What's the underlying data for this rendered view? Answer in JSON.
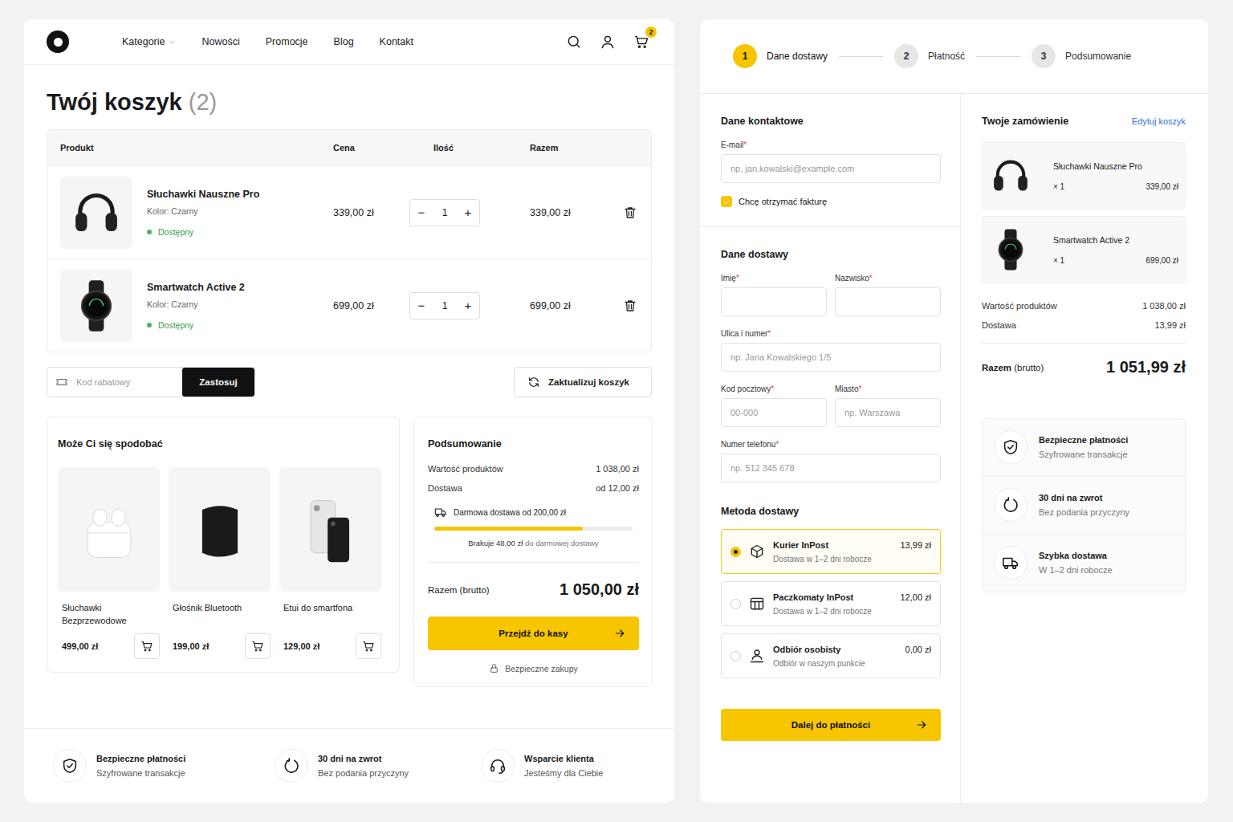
{
  "nav": {
    "items": [
      {
        "label": "Kategorie",
        "dropdown": true
      },
      {
        "label": "Nowości",
        "dropdown": false
      },
      {
        "label": "Promocje",
        "dropdown": false
      },
      {
        "label": "Blog",
        "dropdown": false
      },
      {
        "label": "Kontakt",
        "dropdown": false
      }
    ],
    "cart_badge": "2"
  },
  "cart": {
    "title": "Twój koszyk",
    "count": "(2)",
    "columns": [
      "Produkt",
      "Cena",
      "Ilość",
      "Razem"
    ],
    "qty_minus": "−",
    "qty_plus": "+",
    "items": [
      {
        "name": "Słuchawki Nauszne Pro",
        "color_label": "Kolor: Czarny",
        "availability": "Dostępny",
        "available": true,
        "price": "339,00 zł",
        "qty": "1",
        "total": "339,00 zł",
        "kind": "headphones"
      },
      {
        "name": "Smartwatch Active 2",
        "color_label": "Kolor: Czarny",
        "availability": "Dostępny",
        "available": true,
        "price": "699,00 zł",
        "qty": "1",
        "total": "699,00 zł",
        "kind": "watch"
      }
    ]
  },
  "coupon": {
    "placeholder": "Kod rabatowy",
    "button": "Zastosuj"
  },
  "update_button": "Zaktualizuj koszyk",
  "recommendations": {
    "title": "Może Ci się spodobać",
    "items": [
      {
        "name": "Słuchawki Bezprzewodowe",
        "price": "499,00 zł",
        "kind": "earbuds"
      },
      {
        "name": "Głośnik Bluetooth",
        "price": "199,00 zł",
        "kind": "speaker"
      },
      {
        "name": "Etui do smartfona",
        "price": "129,00 zł",
        "kind": "case"
      }
    ]
  },
  "summary": {
    "title": "Podsumowanie",
    "lines": [
      {
        "label": "Wartość produktów",
        "value": "1 038,00 zł"
      },
      {
        "label": "Dostawa",
        "value": "od 12,00 zł"
      }
    ],
    "free_shipping": {
      "label": "Darmowa dostawa od 200,00 zł",
      "level": 0.75,
      "remaining_amount": "Brakuje 48,00 zł",
      "remaining_rest": "do darmowej dostawy"
    },
    "total_label": "Razem (brutto)",
    "total": "1 050,00 zł",
    "checkout": "Przejdź do kasy",
    "secure": "Bezpieczne zakupy"
  },
  "footer": [
    {
      "title": "Bezpieczne płatności",
      "subtitle": "Szyfrowane transakcje",
      "kind": "shield"
    },
    {
      "title": "30 dni na zwrot",
      "subtitle": "Bez podania przyczyny",
      "kind": "return"
    },
    {
      "title": "Wsparcie klienta",
      "subtitle": "Jesteśmy dla Ciebie",
      "kind": "support"
    }
  ],
  "checkout": {
    "steps": [
      {
        "number": "1",
        "label": "Dane dostawy",
        "selected": true
      },
      {
        "number": "2",
        "label": "Płatność",
        "selected": false
      },
      {
        "number": "3",
        "label": "Podsumowanie",
        "selected": false
      }
    ],
    "required_mark": "*",
    "contact": {
      "title": "Dane kontaktowe",
      "email": {
        "label": "E-mail",
        "placeholder": "np. jan.kowalski@example.com",
        "required": true
      },
      "invoice": {
        "label": "Chcę otrzymać fakturę",
        "checked": true
      }
    },
    "delivery": {
      "title": "Dane dostawy",
      "rows": [
        [
          {
            "label": "Imię",
            "required": true
          },
          {
            "label": "Nazwisko",
            "required": true
          }
        ],
        [
          {
            "label": "Ulica i numer",
            "placeholder": "np. Jana Kowalskiego 1/5",
            "required": true
          }
        ],
        [
          {
            "label": "Kod pocztowy",
            "placeholder": "00-000",
            "required": true
          },
          {
            "label": "Miasto",
            "placeholder": "np. Warszawa",
            "required": true
          }
        ],
        [
          {
            "label": "Numer telefonu",
            "placeholder": "np. 512 345 678",
            "required": true
          }
        ]
      ]
    },
    "methods": {
      "title": "Metoda dostawy",
      "options": [
        {
          "name": "Kurier InPost",
          "detail": "Dostawa w 1–2 dni robocze",
          "price": "13,99 zł",
          "selected": true,
          "kind": "parcel"
        },
        {
          "name": "Paczkomaty InPost",
          "detail": "Dostawa w 1–2 dni robocze",
          "price": "12,00 zł",
          "selected": false,
          "kind": "locker"
        },
        {
          "name": "Odbiór osobisty",
          "detail": "Odbiór w naszym punkcie",
          "price": "0,00 zł",
          "selected": false,
          "kind": "pickup"
        }
      ]
    },
    "next_button": "Dalej do płatności",
    "order": {
      "title": "Twoje zamówienie",
      "edit_link": "Edytuj koszyk",
      "items": [
        {
          "name": "Słuchawki Nauszne Pro",
          "qty": "× 1",
          "price": "339,00 zł",
          "kind": "headphones"
        },
        {
          "name": "Smartwatch Active 2",
          "qty": "× 1",
          "price": "699,00 zł",
          "kind": "watch"
        }
      ],
      "lines": [
        {
          "label": "Wartość produktów",
          "value": "1 038,00 zł"
        },
        {
          "label": "Dostawa",
          "value": "13,99 zł"
        }
      ],
      "total_label": "Razem",
      "total_suffix": "(brutto)",
      "total": "1 051,99 zł"
    },
    "trust": [
      {
        "title": "Bezpieczne płatności",
        "subtitle": "Szyfrowane transakcje",
        "kind": "shield"
      },
      {
        "title": "30 dni na zwrot",
        "subtitle": "Bez podania przyczyny",
        "kind": "return"
      },
      {
        "title": "Szybka dostawa",
        "subtitle": "W 1–2 dni robocze",
        "kind": "truck"
      }
    ]
  }
}
